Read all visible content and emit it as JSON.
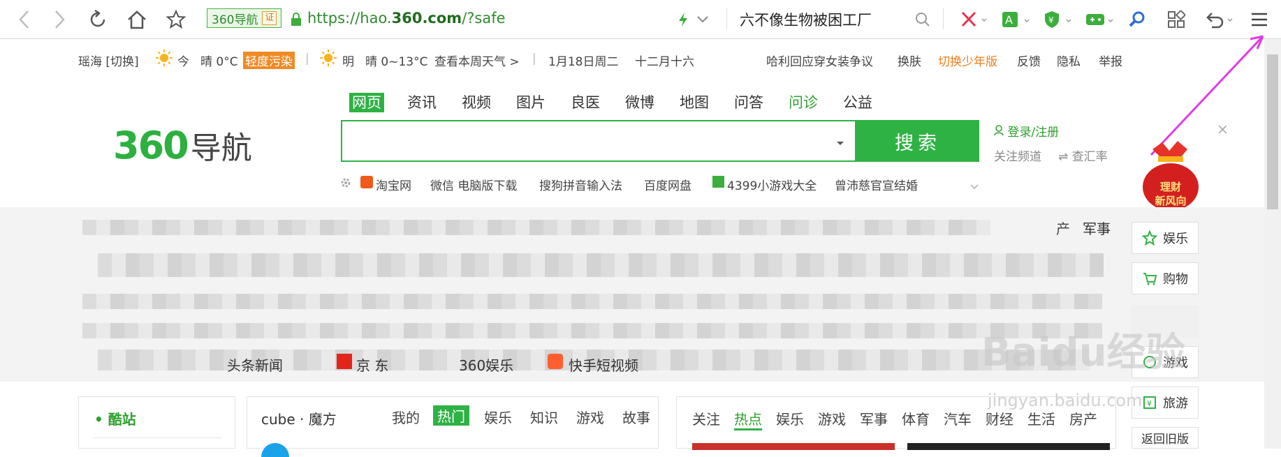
{
  "browser": {
    "badge_text": "360导航",
    "badge_cert": "证",
    "url_prefix": "https://hao.",
    "url_domain": "360.com",
    "url_suffix": "/?safe",
    "search_text": "六不像生物被困工厂"
  },
  "infobar": {
    "city": "瑶海 [切换]",
    "today_label": "今",
    "today_weather": "晴 0°C",
    "pollution": "轻度污染",
    "sep1": "|",
    "tomorrow_label": "明",
    "tomorrow_weather": "晴 0~13°C",
    "week_weather": "查看本周天气 >",
    "sep2": "|",
    "date": "1月18日周二",
    "lunar": "十二月十六",
    "news_link": "哈利回应穿女装争议",
    "skin": "换肤",
    "teen_mode": "切换少年版",
    "feedback": "反馈",
    "privacy": "隐私",
    "report": "举报"
  },
  "search_tabs": [
    {
      "label": "网页"
    },
    {
      "label": "资讯"
    },
    {
      "label": "视频"
    },
    {
      "label": "图片"
    },
    {
      "label": "良医"
    },
    {
      "label": "微博"
    },
    {
      "label": "地图"
    },
    {
      "label": "问答"
    },
    {
      "label": "问诊"
    },
    {
      "label": "公益"
    }
  ],
  "logo": {
    "num": "360",
    "cn": "导航"
  },
  "search_button": "搜索",
  "login": "登录/注册",
  "follow_channel": "关注频道",
  "exchange_rate": "查汇率",
  "close": "×",
  "quick_links": [
    "淘宝网",
    "微信 电脑版下载",
    "搜狗拼音输入法",
    "百度网盘",
    "4399小游戏大全",
    "曾沛慈官宣结婚"
  ],
  "nav_tail": "产",
  "nav_military": "军事",
  "row_links": {
    "toutiao": "头条新闻",
    "jd": "京 东",
    "yule360": "360娱乐",
    "kuaishou": "快手短视频"
  },
  "ad": {
    "line1": "理财",
    "line2": "新风向"
  },
  "side": {
    "entertainment": "娱乐",
    "shopping": "购物",
    "games": "游戏",
    "travel": "旅游",
    "old_version": "返回旧版"
  },
  "cool_site": "酷站",
  "cube_panel": {
    "title": "cube · 魔方",
    "tabs": [
      "我的",
      "热门",
      "娱乐",
      "知识",
      "游戏",
      "故事"
    ]
  },
  "news_panel": {
    "tabs": [
      "关注",
      "热点",
      "娱乐",
      "游戏",
      "军事",
      "体育",
      "汽车",
      "财经",
      "生活",
      "房产"
    ]
  },
  "watermark": {
    "main": "Baidu经验",
    "sub": "jingyan.baidu.com"
  },
  "colors": {
    "brand_green": "#2fb244",
    "pollution": "#f08a24",
    "annotation_arrow": "#e23be8"
  }
}
